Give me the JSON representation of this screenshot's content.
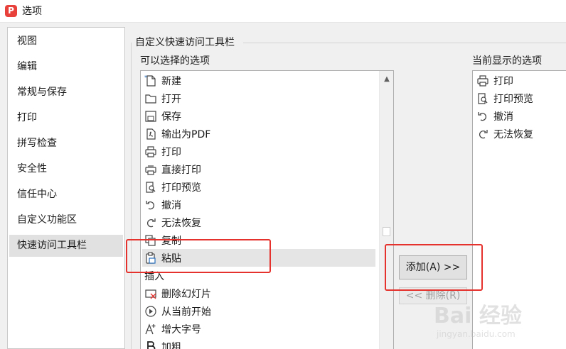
{
  "window": {
    "title": "选项",
    "logo_letter": "P"
  },
  "nav": {
    "items": [
      {
        "label": "视图"
      },
      {
        "label": "编辑"
      },
      {
        "label": "常规与保存"
      },
      {
        "label": "打印"
      },
      {
        "label": "拼写检查"
      },
      {
        "label": "安全性"
      },
      {
        "label": "信任中心"
      },
      {
        "label": "自定义功能区"
      },
      {
        "label": "快速访问工具栏",
        "selected": true
      }
    ]
  },
  "group": {
    "title": "自定义快速访问工具栏"
  },
  "available": {
    "label": "可以选择的选项",
    "items": [
      {
        "label": "新建",
        "icon": "new-file-icon"
      },
      {
        "label": "打开",
        "icon": "folder-open-icon"
      },
      {
        "label": "保存",
        "icon": "save-icon"
      },
      {
        "label": "输出为PDF",
        "icon": "export-pdf-icon"
      },
      {
        "label": "打印",
        "icon": "printer-icon"
      },
      {
        "label": "直接打印",
        "icon": "direct-print-icon"
      },
      {
        "label": "打印预览",
        "icon": "print-preview-icon"
      },
      {
        "label": "撤消",
        "icon": "undo-icon"
      },
      {
        "label": "无法恢复",
        "icon": "redo-icon"
      },
      {
        "label": "复制",
        "icon": "copy-icon"
      },
      {
        "label": "粘贴",
        "icon": "paste-icon",
        "selected": true
      },
      {
        "label": "插入",
        "category": true
      },
      {
        "label": "删除幻灯片",
        "icon": "delete-slide-icon"
      },
      {
        "label": "从当前开始",
        "icon": "play-from-current-icon"
      },
      {
        "label": "增大字号",
        "icon": "increase-font-icon"
      },
      {
        "label": "加粗",
        "icon": "bold-icon"
      }
    ]
  },
  "current": {
    "label": "当前显示的选项",
    "items": [
      {
        "label": "打印",
        "icon": "printer-icon"
      },
      {
        "label": "打印预览",
        "icon": "print-preview-icon"
      },
      {
        "label": "撤消",
        "icon": "undo-icon"
      },
      {
        "label": "无法恢复",
        "icon": "redo-icon"
      }
    ]
  },
  "buttons": {
    "add": "添加(A) >>",
    "remove": "<< 删除(R)"
  },
  "watermark": {
    "main": "Bai 经验",
    "sub": "jingyan.baidu.com"
  },
  "colors": {
    "highlight": "#e5322d",
    "logo": "#e8413b",
    "selection": "#e5e5e5"
  }
}
